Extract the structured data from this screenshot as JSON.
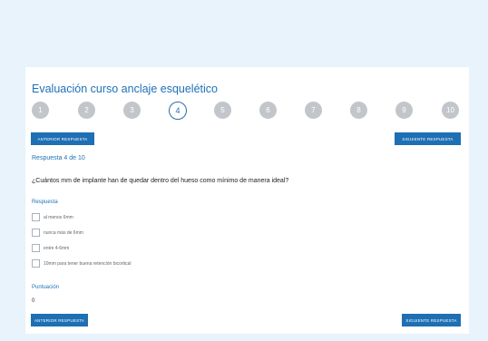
{
  "quiz": {
    "title": "Evaluación curso anclaje esquelético",
    "steps": [
      "1",
      "2",
      "3",
      "4",
      "5",
      "6",
      "7",
      "8",
      "9",
      "10"
    ],
    "active_step": "4",
    "prev_button": "ANTERIOR RESPUESTA",
    "next_button": "SIGUIENTE RESPUESTA",
    "counter": "Respuesta 4 de 10",
    "question": "¿Cuántos mm de implante han de quedar dentro del hueso como mínimo de manera ideal?",
    "answer_label": "Respuesta",
    "options": [
      "al menos 6mm",
      "nunca más de 6mm",
      "entre 4-6mm",
      "10mm para tener buena retención bicortical"
    ],
    "score_label": "Puntuación",
    "score_value": "0"
  },
  "colors": {
    "accent": "#1e6fb3",
    "background": "#e8f3fb",
    "step_inactive": "#c2c6ca"
  }
}
